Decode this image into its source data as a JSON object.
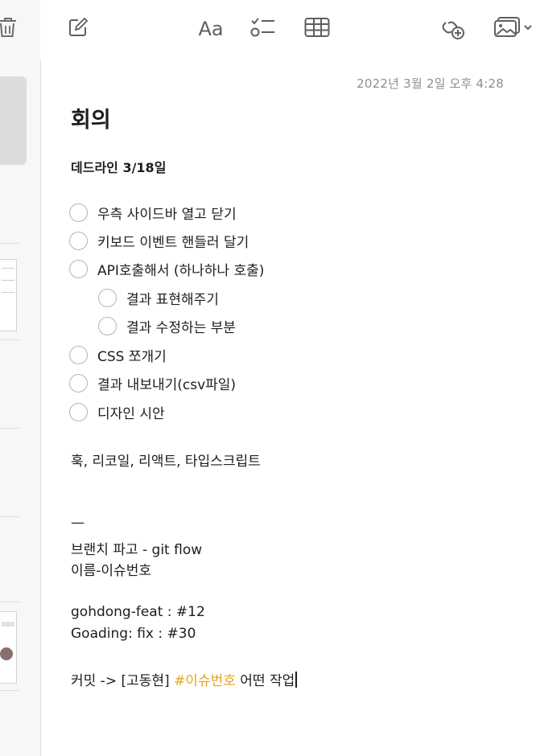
{
  "toolbar": {
    "format_label": "Aa"
  },
  "note": {
    "date": "2022년 3월 2일 오후 4:28",
    "title": "회의",
    "subtitle": "데드라인 3/18일",
    "checklist": [
      {
        "label": "우측 사이드바 열고 닫기",
        "checked": false
      },
      {
        "label": "키보드 이벤트 핸들러 달기",
        "checked": false
      },
      {
        "label": "API호출해서 (하나하나 호출)",
        "checked": false
      },
      {
        "label": "결과 표현해주기",
        "checked": false
      },
      {
        "label": "결과 수정하는 부분",
        "checked": false
      },
      {
        "label": "CSS 쪼개기",
        "checked": false
      },
      {
        "label": "결과 내보내기(csv파일)",
        "checked": false
      },
      {
        "label": "디자인 시안",
        "checked": false
      }
    ],
    "stack_line": "훅, 리코일, 리액트, 타입스크립트",
    "dash": "—",
    "branch_line": "브랜치 파고 - git flow",
    "name_line": "이름-이슈번호",
    "example1": "gohdong-feat : #12",
    "example2": "Goading: fix : #30",
    "commit_prefix": "커밋 -> [고동현] ",
    "commit_tag": "#이슈번호",
    "commit_suffix": " 어떤 작업"
  },
  "colors": {
    "tag": "#e3a51d",
    "spell_underline": "#e0454a",
    "date": "#8e8e8e"
  },
  "icons": [
    "trash-icon",
    "compose-icon",
    "checklist-icon",
    "table-icon",
    "collaborate-icon",
    "media-icon"
  ]
}
